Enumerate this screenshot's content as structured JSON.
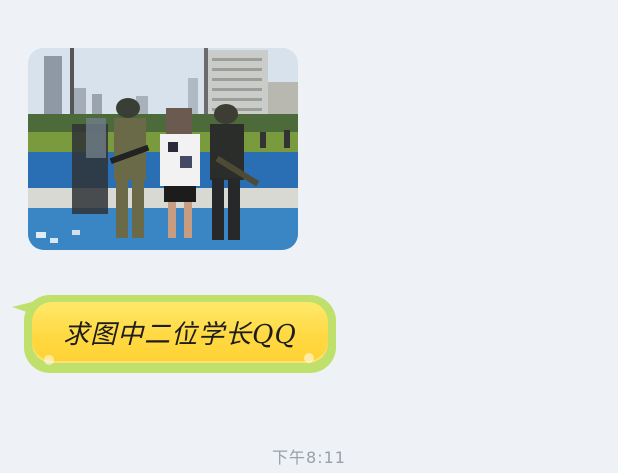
{
  "messages": [
    {
      "type": "image",
      "description_icon": "photo-icon"
    },
    {
      "type": "text",
      "text": "求图中二位学长QQ"
    }
  ],
  "timestamp": "下午8:11",
  "colors": {
    "background": "#eef1f6",
    "bubble_outer": "#bfe06a",
    "bubble_fill": "#ffd943",
    "timestamp_text": "#9aa0a8"
  }
}
